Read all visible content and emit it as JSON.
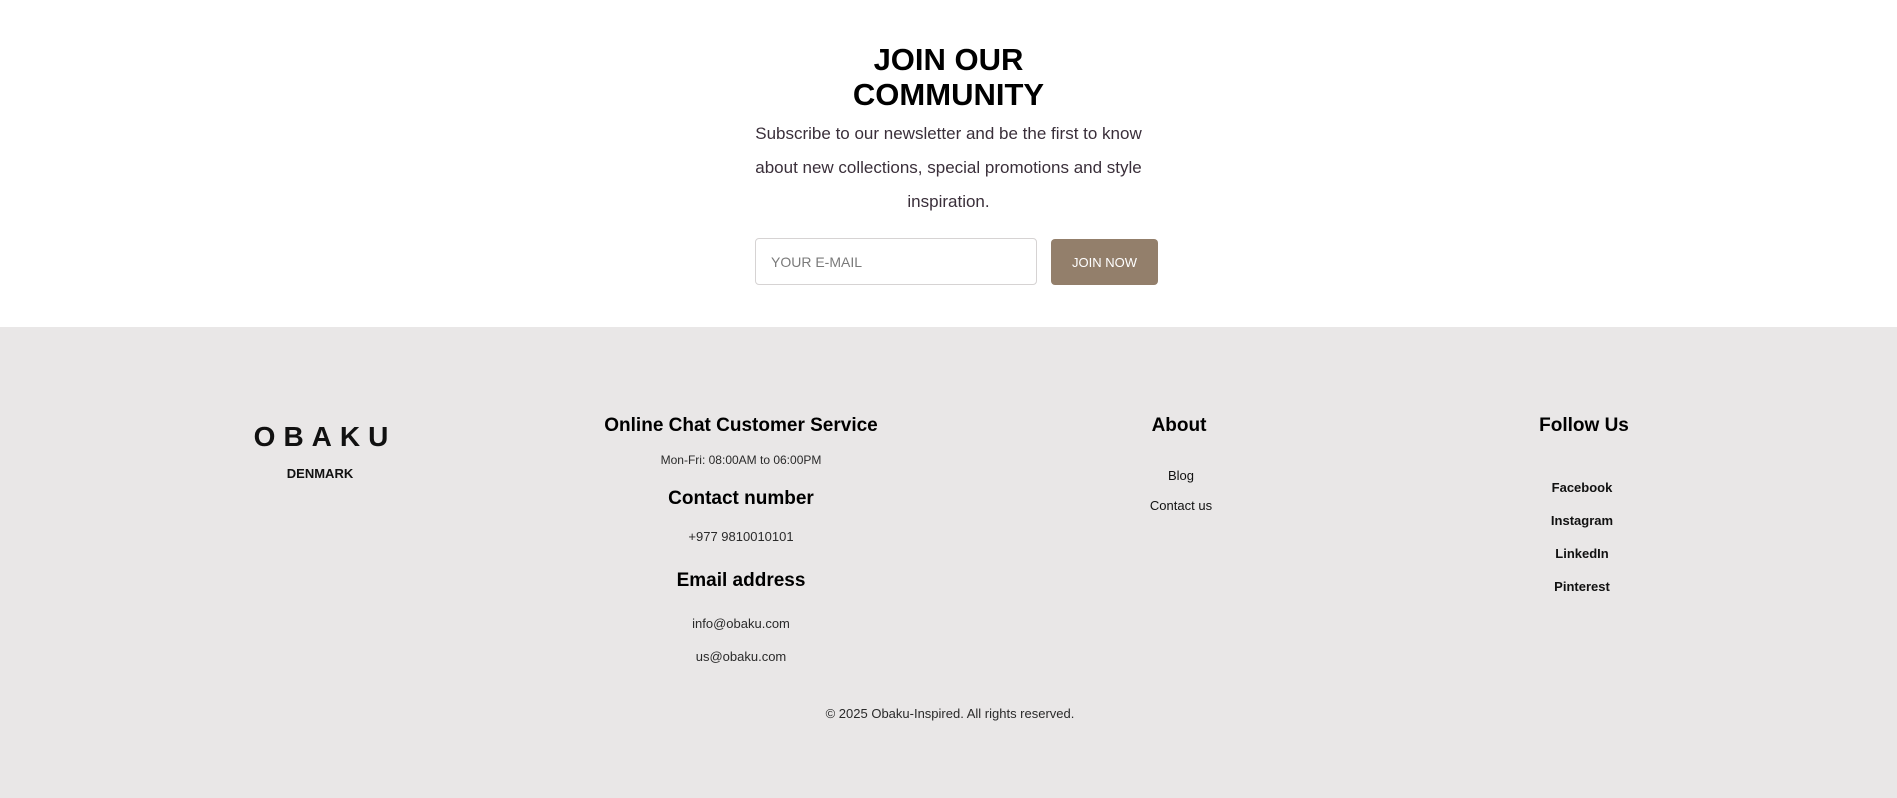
{
  "newsletter": {
    "title_line1": "JOIN OUR",
    "title_line2": "COMMUNITY",
    "text_line1": "Subscribe to our newsletter and be the first to know",
    "text_line2": "about new collections, special promotions and style",
    "text_line3": "inspiration.",
    "email_placeholder": "YOUR E-MAIL",
    "email_value": "",
    "button_label": "JOIN NOW"
  },
  "footer": {
    "brand": {
      "logo": "OBAKU",
      "subtitle": "DENMARK"
    },
    "customer_service": {
      "chat_heading": "Online Chat Customer Service",
      "hours": "Mon-Fri: 08:00AM to 06:00PM",
      "contact_heading": "Contact number",
      "phone": "+977 9810010101",
      "email_heading": "Email address",
      "email1": "info@obaku.com",
      "email2": "us@obaku.com"
    },
    "about": {
      "heading": "About",
      "links": [
        "Blog",
        "Contact us"
      ]
    },
    "follow": {
      "heading": "Follow Us",
      "links": [
        "Facebook",
        "Instagram",
        "LinkedIn",
        "Pinterest"
      ]
    },
    "copyright": "© 2025 Obaku-Inspired. All rights reserved."
  },
  "colors": {
    "button_bg": "#937f6b",
    "footer_bg": "#e9e7e7",
    "page_bg": "#ffffff"
  }
}
